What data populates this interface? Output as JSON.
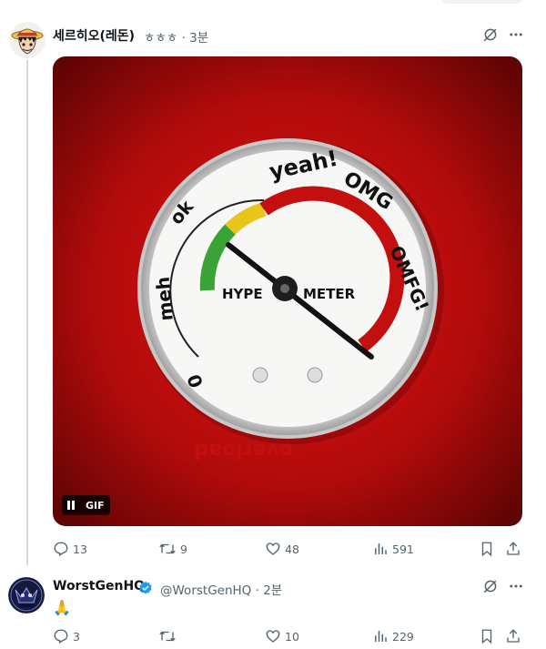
{
  "tweet1": {
    "display_name": "세르히오(레돈)",
    "handle": "ㅎㅎㅎ",
    "time": "3분",
    "media": {
      "badge": "GIF",
      "gauge": {
        "top_words": [
          "yeah!",
          "OMG",
          "OMFG!",
          "overload",
          "meh",
          "ok",
          "0"
        ],
        "center_left": "HYPE",
        "center_right": "METER"
      }
    },
    "stats": {
      "replies": "13",
      "retweets": "9",
      "likes": "48",
      "views": "591"
    }
  },
  "tweet2": {
    "display_name": "WorstGenHQ",
    "handle": "@WorstGenHQ",
    "time": "2분",
    "text": "🙏",
    "stats": {
      "replies": "3",
      "retweets": "",
      "likes": "10",
      "views": "229"
    }
  },
  "colors": {
    "accent": "#1d9bf0",
    "muted": "#536471",
    "gauge_red": "#c40f0f",
    "gauge_green": "#3aa335",
    "gauge_yellow": "#e9c41b"
  }
}
